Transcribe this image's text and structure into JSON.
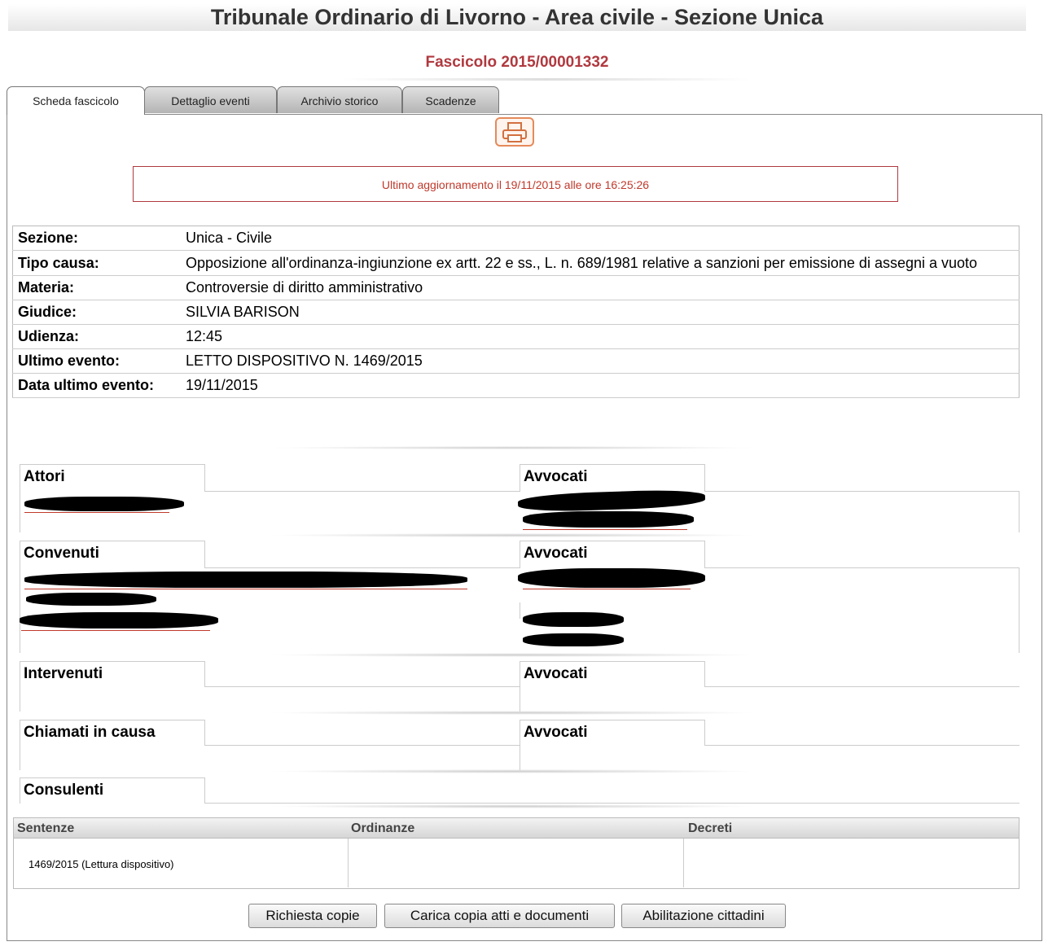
{
  "header": {
    "title": "Tribunale Ordinario di Livorno - Area civile - Sezione Unica",
    "fascicolo": "Fascicolo 2015/00001332"
  },
  "tabs": [
    {
      "label": "Scheda fascicolo",
      "active": true
    },
    {
      "label": "Dettaglio eventi",
      "active": false
    },
    {
      "label": "Archivio storico",
      "active": false
    },
    {
      "label": "Scadenze",
      "active": false
    }
  ],
  "print_icon": "printer-icon",
  "update_notice": "Ultimo aggiornamento il 19/11/2015 alle ore 16:25:26",
  "info": {
    "sezione": {
      "label": "Sezione:",
      "value": "Unica -  Civile"
    },
    "tipo_causa": {
      "label": "Tipo causa:",
      "value": "Opposizione all'ordinanza-ingiunzione ex artt. 22 e ss., L. n. 689/1981 relative a sanzioni per emissione di assegni a vuoto"
    },
    "materia": {
      "label": "Materia:",
      "value": "Controversie di diritto amministrativo"
    },
    "giudice": {
      "label": "Giudice:",
      "value": "SILVIA BARISON"
    },
    "udienza": {
      "label": "Udienza:",
      "value": "12:45"
    },
    "ultimo_evento": {
      "label": "Ultimo evento:",
      "value": "LETTO DISPOSITIVO N. 1469/2015"
    },
    "data_ultimo_evento": {
      "label": "Data ultimo evento:",
      "value": "19/11/2015"
    }
  },
  "parties": {
    "attori": "Attori",
    "convenuti": "Convenuti",
    "intervenuti": "Intervenuti",
    "chiamati": "Chiamati in causa",
    "consulenti": "Consulenti",
    "avvocati": "Avvocati"
  },
  "provvedimenti": {
    "headers": [
      "Sentenze",
      "Ordinanze",
      "Decreti"
    ],
    "sentenze": [
      "1469/2015 (Lettura dispositivo)"
    ]
  },
  "buttons": {
    "richiesta": "Richiesta copie",
    "carica": "Carica copia atti e documenti",
    "abilitazione": "Abilitazione cittadini"
  },
  "colors": {
    "accent_red": "#b0393f",
    "print_orange": "#e58a5a"
  }
}
